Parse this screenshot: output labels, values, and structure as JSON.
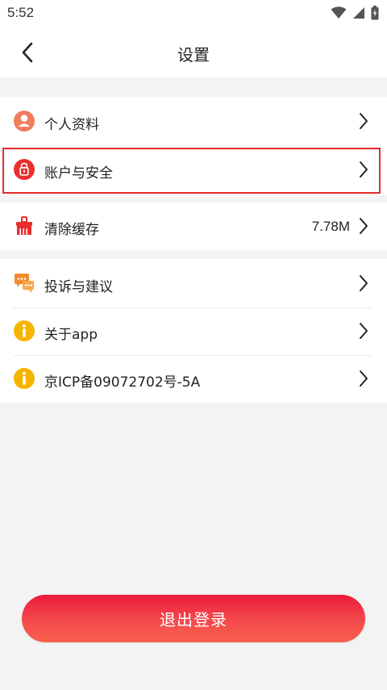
{
  "status_bar": {
    "time": "5:52",
    "icons": [
      "wifi-icon",
      "signal-icon",
      "battery-icon"
    ]
  },
  "header": {
    "title": "设置",
    "back_icon": "chevron-left-icon"
  },
  "settings": {
    "group1": [
      {
        "label": "个人资料",
        "icon": "person-icon"
      },
      {
        "label": "账户与安全",
        "icon": "lock-icon"
      }
    ],
    "group2": [
      {
        "label": "清除缓存",
        "value": "7.78M",
        "icon": "broom-icon"
      }
    ],
    "group3": [
      {
        "label": "投诉与建议",
        "icon": "chat-bubbles-icon"
      },
      {
        "label": "关于app",
        "icon": "info-icon"
      },
      {
        "label": "京ICP备09072702号-5A",
        "icon": "info-icon"
      }
    ]
  },
  "logout": {
    "label": "退出登录"
  },
  "colors": {
    "accent_red": "#e32b2b",
    "logout_gradient_top": "#ec1b3c",
    "logout_gradient_bottom": "#f8614e",
    "info_yellow": "#f5b400",
    "chat_orange": "#f08a2c",
    "background": "#f3f3f3"
  }
}
